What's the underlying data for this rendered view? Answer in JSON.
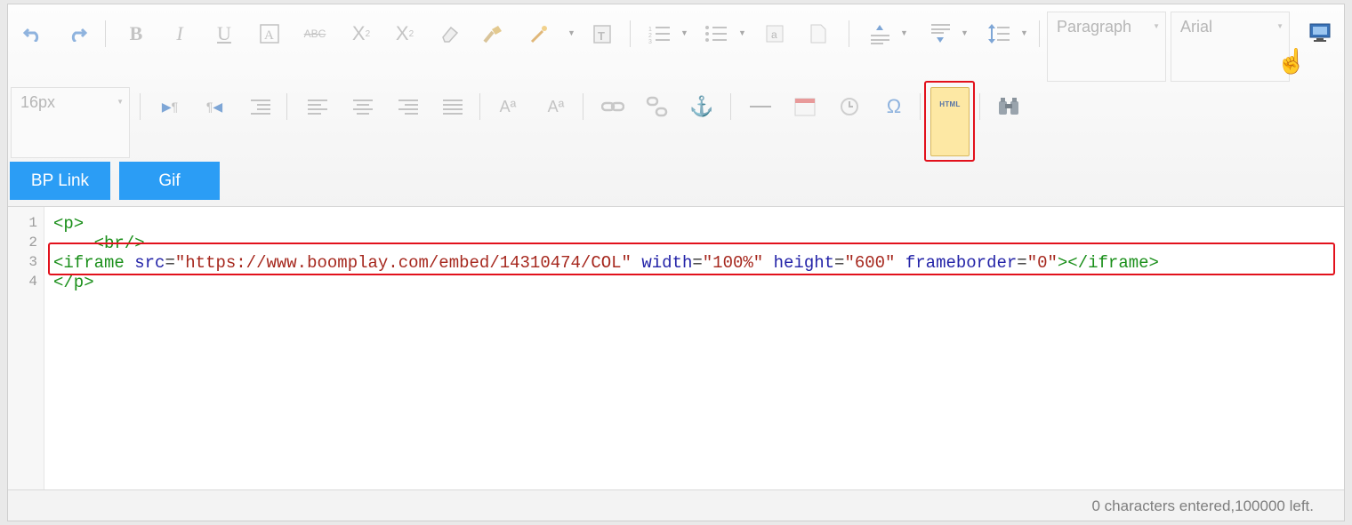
{
  "toolbar": {
    "format_select": "Paragraph",
    "font_select": "Arial",
    "size_select": "16px",
    "html_button_label": "HTML",
    "bp_link_label": "BP Link",
    "gif_label": "Gif"
  },
  "code": {
    "line_numbers": [
      "1",
      "2",
      "3",
      "4"
    ],
    "line1": "<p>",
    "line2": "    <br/>",
    "line3": {
      "open": "<iframe",
      "src_attr": "src",
      "src_val": "\"https://www.boomplay.com/embed/14310474/COL\"",
      "width_attr": "width",
      "width_val": "\"100%\"",
      "height_attr": "height",
      "height_val": "\"600\"",
      "frameborder_attr": "frameborder",
      "frameborder_val": "\"0\"",
      "close": "></iframe>"
    },
    "line4": "</p>"
  },
  "status": {
    "counter": "0 characters entered,100000 left."
  },
  "icons": [
    "undo-icon",
    "redo-icon",
    "bold-icon",
    "italic-icon",
    "underline-icon",
    "font-border-icon",
    "strikethrough-icon",
    "superscript-icon",
    "subscript-icon",
    "eraser-icon",
    "format-painter-icon",
    "magic-wand-icon",
    "paste-text-icon",
    "ordered-list-icon",
    "unordered-list-icon",
    "select-all-icon",
    "clear-doc-icon",
    "row-spacing-top-icon",
    "row-spacing-bottom-icon",
    "line-height-icon",
    "fullscreen-icon",
    "ltr-icon",
    "rtl-icon",
    "indent-icon",
    "align-left-icon",
    "align-center-icon",
    "align-right-icon",
    "justify-icon",
    "to-uppercase-icon",
    "to-lowercase-icon",
    "link-icon",
    "unlink-icon",
    "anchor-icon",
    "horizontal-rule-icon",
    "date-icon",
    "time-icon",
    "special-chars-icon",
    "html-source-icon",
    "search-replace-icon",
    "hand-cursor-icon"
  ]
}
